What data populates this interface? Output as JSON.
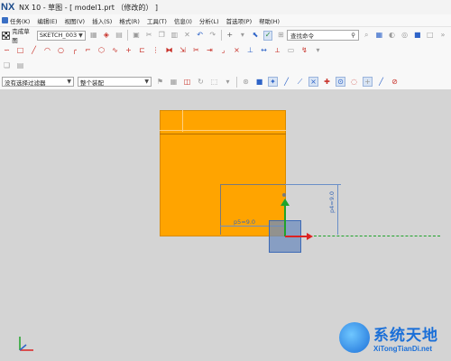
{
  "window": {
    "logo": "NX",
    "title": "NX 10 - 草图 - [ model1.prt （修改的） ]"
  },
  "menu": {
    "items": [
      {
        "label": "任务(K)",
        "icon": "task-icon"
      },
      {
        "label": "编辑(E)"
      },
      {
        "label": "视图(V)"
      },
      {
        "label": "插入(S)"
      },
      {
        "label": "格式(R)"
      },
      {
        "label": "工具(T)"
      },
      {
        "label": "信息(I)"
      },
      {
        "label": "分析(L)"
      },
      {
        "label": "首选项(P)"
      },
      {
        "label": "帮助(H)"
      }
    ]
  },
  "toolbar": {
    "finish_sketch_label": "完成草图",
    "sketch_name": "SKETCH_003",
    "search_placeholder": "查找命令",
    "selection_filter": "没有选择过滤器",
    "assembly_scope": "整个装配"
  },
  "sketch": {
    "dim_vertical": "p4=9.0",
    "dim_horizontal": "p5=9.0"
  },
  "watermark": {
    "main": "系统天地",
    "sub": "XiTongTianDi.net"
  },
  "colors": {
    "sketch_fill": "#ffa400",
    "selection": "#6e8cbe",
    "axis_x": "#dd2222",
    "axis_y": "#1fa32a",
    "dimension": "#3d6ab5",
    "background": "#d4d4d4"
  }
}
